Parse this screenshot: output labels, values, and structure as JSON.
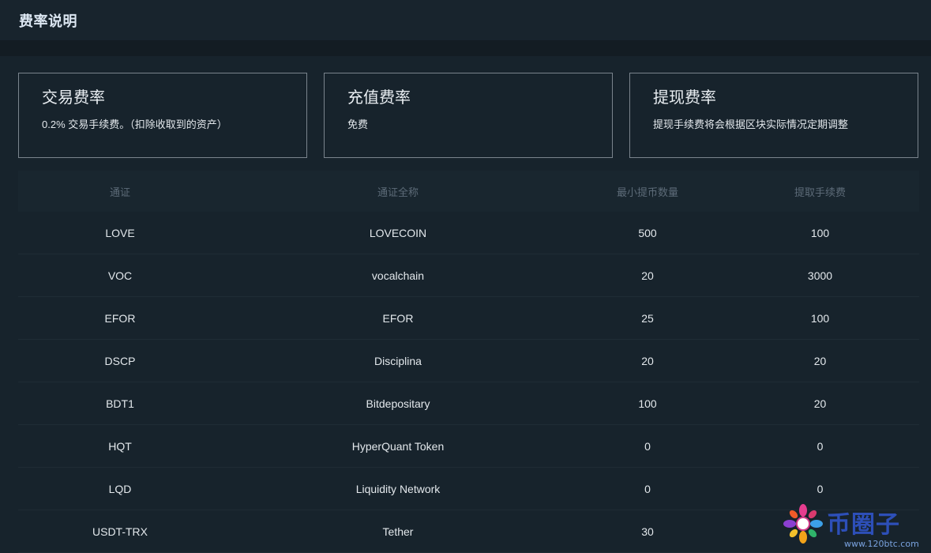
{
  "header": {
    "title": "费率说明"
  },
  "cards": [
    {
      "title": "交易费率",
      "desc": "0.2% 交易手续费。（扣除收取到的资产）"
    },
    {
      "title": "充值费率",
      "desc": "免费"
    },
    {
      "title": "提现费率",
      "desc": "提现手续费将会根据区块实际情况定期调整"
    }
  ],
  "table": {
    "headers": [
      "通证",
      "通证全称",
      "最小提币数量",
      "提取手续费"
    ],
    "rows": [
      {
        "symbol": "LOVE",
        "name": "LOVECOIN",
        "min": "500",
        "fee": "100"
      },
      {
        "symbol": "VOC",
        "name": "vocalchain",
        "min": "20",
        "fee": "3000"
      },
      {
        "symbol": "EFOR",
        "name": "EFOR",
        "min": "25",
        "fee": "100"
      },
      {
        "symbol": "DSCP",
        "name": "Disciplina",
        "min": "20",
        "fee": "20"
      },
      {
        "symbol": "BDT1",
        "name": "Bitdepositary",
        "min": "100",
        "fee": "20"
      },
      {
        "symbol": "HQT",
        "name": "HyperQuant Token",
        "min": "0",
        "fee": "0"
      },
      {
        "symbol": "LQD",
        "name": "Liquidity Network",
        "min": "0",
        "fee": "0"
      },
      {
        "symbol": "USDT-TRX",
        "name": "Tether",
        "min": "30",
        "fee": ""
      }
    ]
  },
  "watermark": {
    "text": "币圈子",
    "url": "www.120btc.com"
  },
  "colors": {
    "background": "#17232c",
    "header_bg": "#18242d",
    "card_border": "#7a848d",
    "table_header_text": "#5d6b78",
    "watermark": "#2d4fb8"
  }
}
